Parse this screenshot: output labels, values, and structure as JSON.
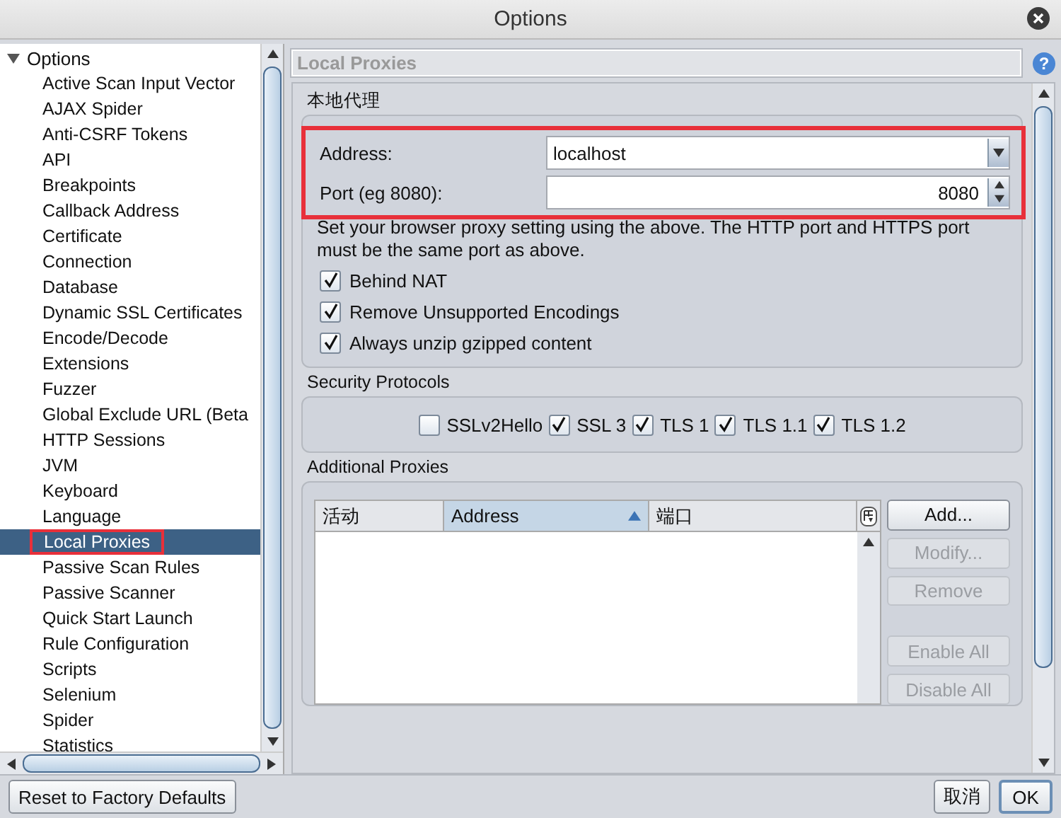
{
  "window": {
    "title": "Options"
  },
  "tree": {
    "root": {
      "label": "Options",
      "expanded": true,
      "children": [
        {
          "label": "Active Scan Input Vector",
          "selected": false
        },
        {
          "label": "AJAX Spider",
          "selected": false
        },
        {
          "label": "Anti-CSRF Tokens",
          "selected": false
        },
        {
          "label": "API",
          "selected": false
        },
        {
          "label": "Breakpoints",
          "selected": false
        },
        {
          "label": "Callback Address",
          "selected": false
        },
        {
          "label": "Certificate",
          "selected": false
        },
        {
          "label": "Connection",
          "selected": false
        },
        {
          "label": "Database",
          "selected": false
        },
        {
          "label": "Dynamic SSL Certificates",
          "selected": false
        },
        {
          "label": "Encode/Decode",
          "selected": false
        },
        {
          "label": "Extensions",
          "selected": false
        },
        {
          "label": "Fuzzer",
          "selected": false
        },
        {
          "label": "Global Exclude URL (Beta",
          "selected": false
        },
        {
          "label": "HTTP Sessions",
          "selected": false
        },
        {
          "label": "JVM",
          "selected": false
        },
        {
          "label": "Keyboard",
          "selected": false
        },
        {
          "label": "Language",
          "selected": false
        },
        {
          "label": "Local Proxies",
          "selected": true
        },
        {
          "label": "Passive Scan Rules",
          "selected": false
        },
        {
          "label": "Passive Scanner",
          "selected": false
        },
        {
          "label": "Quick Start Launch",
          "selected": false
        },
        {
          "label": "Rule Configuration",
          "selected": false
        },
        {
          "label": "Scripts",
          "selected": false
        },
        {
          "label": "Selenium",
          "selected": false
        },
        {
          "label": "Spider",
          "selected": false
        },
        {
          "label": "Statistics",
          "selected": false
        }
      ]
    }
  },
  "panel": {
    "title": "Local Proxies",
    "help": "?",
    "local_proxy": {
      "heading": "本地代理",
      "address_label": "Address:",
      "address_value": "localhost",
      "port_label": "Port (eg 8080):",
      "port_value": "8080",
      "hint": "Set your browser proxy setting using the above.  The HTTP port and HTTPS port must be the same port as above.",
      "options": [
        {
          "label": "Behind NAT",
          "checked": true
        },
        {
          "label": "Remove Unsupported Encodings",
          "checked": true
        },
        {
          "label": "Always unzip gzipped content",
          "checked": true
        }
      ]
    },
    "security": {
      "heading": "Security Protocols",
      "protocols": [
        {
          "label": "SSLv2Hello",
          "checked": false
        },
        {
          "label": "SSL 3",
          "checked": true
        },
        {
          "label": "TLS 1",
          "checked": true
        },
        {
          "label": "TLS 1.1",
          "checked": true
        },
        {
          "label": "TLS 1.2",
          "checked": true
        }
      ]
    },
    "additional": {
      "heading": "Additional Proxies",
      "columns": [
        {
          "label": "活动",
          "sorted": false
        },
        {
          "label": "Address",
          "sorted": true
        },
        {
          "label": "端口",
          "sorted": false
        }
      ],
      "buttons": [
        {
          "label": "Add...",
          "disabled": false
        },
        {
          "label": "Modify...",
          "disabled": true
        },
        {
          "label": "Remove",
          "disabled": true
        },
        {
          "label": "Enable All",
          "disabled": true
        },
        {
          "label": "Disable All",
          "disabled": true
        }
      ]
    }
  },
  "footer": {
    "reset": "Reset to Factory Defaults",
    "cancel": "取消",
    "ok": "OK"
  }
}
